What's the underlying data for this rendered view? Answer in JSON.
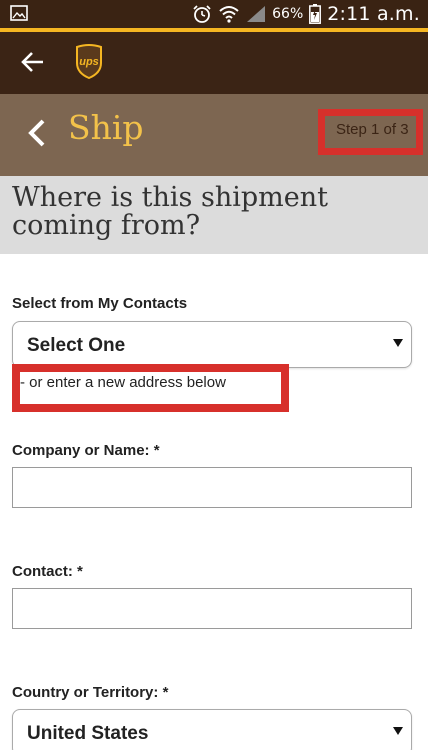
{
  "status_bar": {
    "battery_percent": "66%",
    "time": "2:11 a.m."
  },
  "toolbar": {
    "back_icon": "arrow-left-icon",
    "logo": "ups"
  },
  "ship_header": {
    "title": "Ship",
    "step": "Step 1 of 3"
  },
  "question": "Where is this shipment coming from?",
  "form": {
    "contacts_label": "Select from My Contacts",
    "contacts_value": "Select One",
    "new_address_hint": "- or enter a new address below",
    "company_label": "Company or Name: *",
    "company_value": "",
    "contact_label": "Contact: *",
    "contact_value": "",
    "country_label": "Country or Territory: *",
    "country_value": "United States"
  },
  "colors": {
    "brown_dark": "#3b2415",
    "brown_header": "#7d6651",
    "gold": "#f5b622",
    "highlight_red": "#d7302b"
  }
}
